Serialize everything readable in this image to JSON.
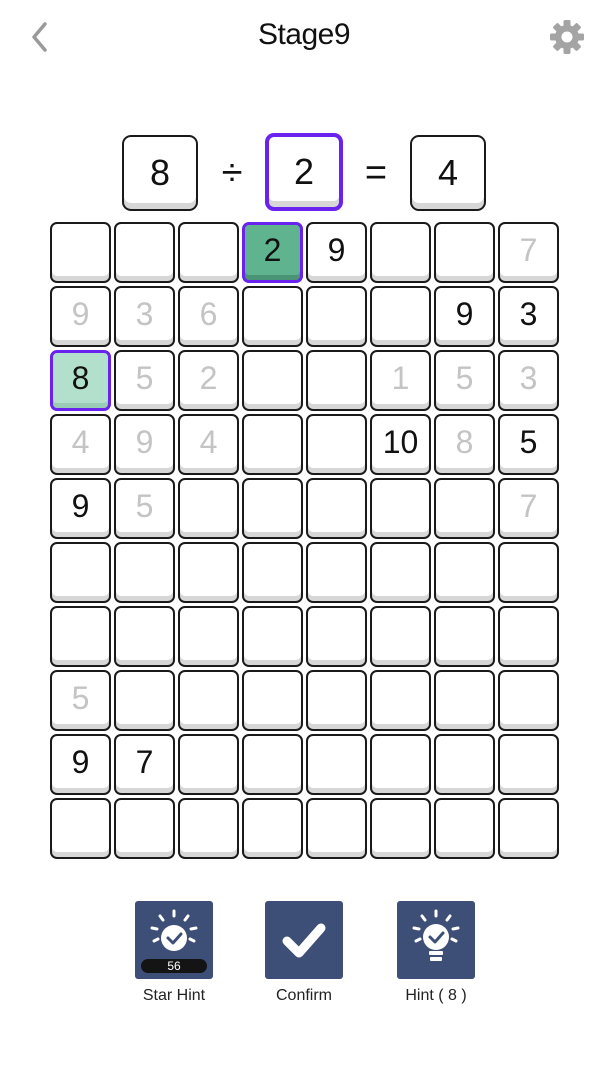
{
  "header": {
    "title": "Stage9",
    "back_icon": "chevron-left-icon",
    "settings_icon": "gear-icon"
  },
  "equation": {
    "left": "8",
    "operator": "÷",
    "middle": "2",
    "equals": "=",
    "result": "4"
  },
  "grid": {
    "rows": [
      [
        {
          "v": ""
        },
        {
          "v": ""
        },
        {
          "v": ""
        },
        {
          "v": "2",
          "s": "sel-dark"
        },
        {
          "v": "9"
        },
        {
          "v": ""
        },
        {
          "v": ""
        },
        {
          "v": "7",
          "s": "faded"
        }
      ],
      [
        {
          "v": "9",
          "s": "faded"
        },
        {
          "v": "3",
          "s": "faded"
        },
        {
          "v": "6",
          "s": "faded"
        },
        {
          "v": ""
        },
        {
          "v": ""
        },
        {
          "v": ""
        },
        {
          "v": "9"
        },
        {
          "v": "3"
        }
      ],
      [
        {
          "v": "8",
          "s": "sel-light"
        },
        {
          "v": "5",
          "s": "faded"
        },
        {
          "v": "2",
          "s": "faded"
        },
        {
          "v": ""
        },
        {
          "v": ""
        },
        {
          "v": "1",
          "s": "faded"
        },
        {
          "v": "5",
          "s": "faded"
        },
        {
          "v": "3",
          "s": "faded"
        }
      ],
      [
        {
          "v": "4",
          "s": "faded"
        },
        {
          "v": "9",
          "s": "faded"
        },
        {
          "v": "4",
          "s": "faded"
        },
        {
          "v": ""
        },
        {
          "v": ""
        },
        {
          "v": "10"
        },
        {
          "v": "8",
          "s": "faded"
        },
        {
          "v": "5"
        }
      ],
      [
        {
          "v": "9"
        },
        {
          "v": "5",
          "s": "faded"
        },
        {
          "v": ""
        },
        {
          "v": ""
        },
        {
          "v": ""
        },
        {
          "v": ""
        },
        {
          "v": ""
        },
        {
          "v": "7",
          "s": "faded"
        }
      ],
      [
        {
          "v": ""
        },
        {
          "v": ""
        },
        {
          "v": ""
        },
        {
          "v": ""
        },
        {
          "v": ""
        },
        {
          "v": ""
        },
        {
          "v": ""
        },
        {
          "v": ""
        }
      ],
      [
        {
          "v": ""
        },
        {
          "v": ""
        },
        {
          "v": ""
        },
        {
          "v": ""
        },
        {
          "v": ""
        },
        {
          "v": ""
        },
        {
          "v": ""
        },
        {
          "v": ""
        }
      ],
      [
        {
          "v": "5",
          "s": "faded"
        },
        {
          "v": ""
        },
        {
          "v": ""
        },
        {
          "v": ""
        },
        {
          "v": ""
        },
        {
          "v": ""
        },
        {
          "v": ""
        },
        {
          "v": ""
        }
      ],
      [
        {
          "v": "9"
        },
        {
          "v": "7"
        },
        {
          "v": ""
        },
        {
          "v": ""
        },
        {
          "v": ""
        },
        {
          "v": ""
        },
        {
          "v": ""
        },
        {
          "v": ""
        }
      ],
      [
        {
          "v": ""
        },
        {
          "v": ""
        },
        {
          "v": ""
        },
        {
          "v": ""
        },
        {
          "v": ""
        },
        {
          "v": ""
        },
        {
          "v": ""
        },
        {
          "v": ""
        }
      ]
    ]
  },
  "actions": {
    "star_hint": {
      "label": "Star Hint",
      "count": "56",
      "icon": "lightbulb-check-icon"
    },
    "confirm": {
      "label": "Confirm",
      "icon": "checkmark-icon"
    },
    "hint": {
      "label": "Hint ( 8 )",
      "icon": "lightbulb-icon"
    }
  },
  "colors": {
    "accent": "#6a22ee",
    "selected_dark": "#5fb38e",
    "selected_light": "#b3e0cc",
    "button_bg": "#3e4f77",
    "faded_text": "#c4c4c4"
  }
}
